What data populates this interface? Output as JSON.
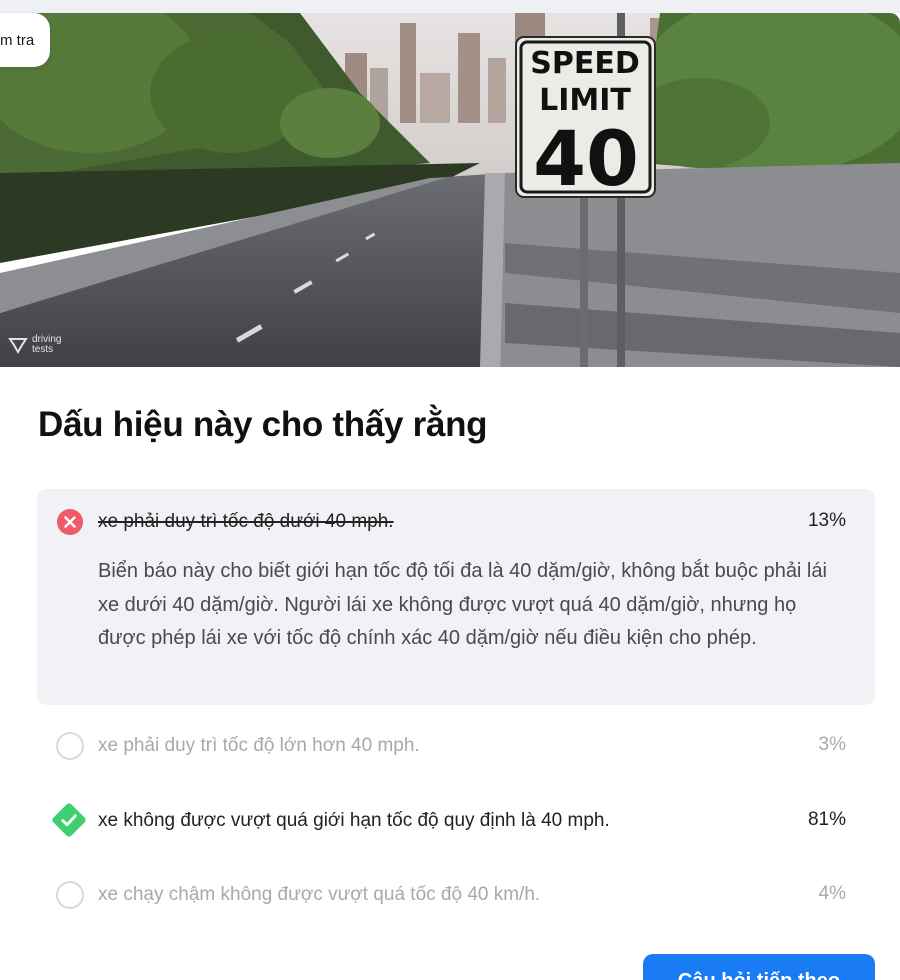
{
  "header": {
    "badge_label": "m tra"
  },
  "hero": {
    "sign_line1": "SPEED",
    "sign_line2": "LIMIT",
    "sign_value": "40",
    "watermark": "driving\ntests"
  },
  "question": {
    "title": "Dấu hiệu này cho thấy rằng"
  },
  "options": [
    {
      "text": "xe phải duy trì tốc độ dưới 40 mph.",
      "percent": "13%",
      "state": "wrong-selected",
      "explanation": "Biển báo này cho biết giới hạn tốc độ tối đa là 40 dặm/giờ, không bắt buộc phải lái xe dưới 40 dặm/giờ. Người lái xe không được vượt quá 40 dặm/giờ, nhưng họ được phép lái xe với tốc độ chính xác 40 dặm/giờ nếu điều kiện cho phép."
    },
    {
      "text": "xe phải duy trì tốc độ lớn hơn 40 mph.",
      "percent": "3%",
      "state": "unselected"
    },
    {
      "text": "xe không được vượt quá giới hạn tốc độ quy định là 40 mph.",
      "percent": "81%",
      "state": "correct"
    },
    {
      "text": "xe chạy chậm không được vượt quá tốc độ 40 km/h.",
      "percent": "4%",
      "state": "unselected"
    }
  ],
  "footer": {
    "continue_label": "Câu hỏi tiếp theo"
  },
  "colors": {
    "wrong": "#f05a6a",
    "correct": "#3ecf6e",
    "primary": "#1a7cf5"
  }
}
